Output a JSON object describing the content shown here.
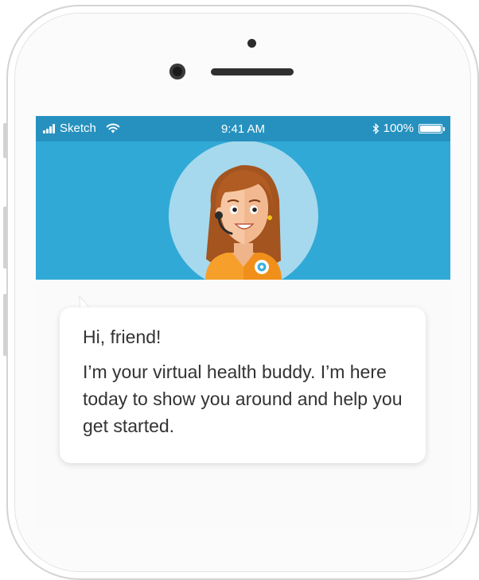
{
  "status_bar": {
    "carrier": "Sketch",
    "time": "9:41 AM",
    "battery": "100%",
    "battery_level": 1.0,
    "icons": [
      "signal-bars-icon",
      "wifi-icon",
      "bluetooth-icon",
      "battery-icon"
    ]
  },
  "colors": {
    "status_bar": "#2691bf",
    "hero": "#31a9d6",
    "avatar_circle": "#a6d9ed",
    "uniform": "#f6a02b",
    "text": "#333333"
  },
  "chat": {
    "greeting": "Hi, friend!",
    "message": "I’m your virtual health buddy. I’m here today to show you around and help you get started."
  }
}
